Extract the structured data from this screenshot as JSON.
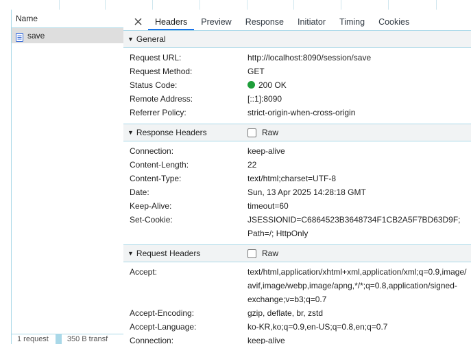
{
  "request_list": {
    "column_header": "Name",
    "selected_request": "save",
    "footer": {
      "requests": "1 request",
      "transferred": "350 B transf"
    }
  },
  "detail": {
    "tabs": [
      {
        "label": "Headers",
        "active": true
      },
      {
        "label": "Preview",
        "active": false
      },
      {
        "label": "Response",
        "active": false
      },
      {
        "label": "Initiator",
        "active": false
      },
      {
        "label": "Timing",
        "active": false
      },
      {
        "label": "Cookies",
        "active": false
      }
    ],
    "general": {
      "title": "General",
      "rows": [
        {
          "key": "Request URL:",
          "value": "http://localhost:8090/session/save"
        },
        {
          "key": "Request Method:",
          "value": "GET"
        },
        {
          "key": "Status Code:",
          "value": "200 OK"
        },
        {
          "key": "Remote Address:",
          "value": "[::1]:8090"
        },
        {
          "key": "Referrer Policy:",
          "value": "strict-origin-when-cross-origin"
        }
      ]
    },
    "response_headers": {
      "title": "Response Headers",
      "raw_label": "Raw",
      "rows": [
        {
          "key": "Connection:",
          "lines": [
            "keep-alive"
          ]
        },
        {
          "key": "Content-Length:",
          "lines": [
            "22"
          ]
        },
        {
          "key": "Content-Type:",
          "lines": [
            "text/html;charset=UTF-8"
          ]
        },
        {
          "key": "Date:",
          "lines": [
            "Sun, 13 Apr 2025 14:28:18 GMT"
          ]
        },
        {
          "key": "Keep-Alive:",
          "lines": [
            "timeout=60"
          ]
        },
        {
          "key": "Set-Cookie:",
          "lines": [
            "JSESSIONID=C6864523B3648734F1CB2A5F7BD63D9F;",
            "Path=/; HttpOnly"
          ]
        }
      ]
    },
    "request_headers": {
      "title": "Request Headers",
      "raw_label": "Raw",
      "rows": [
        {
          "key": "Accept:",
          "lines": [
            "text/html,application/xhtml+xml,application/xml;q=0.9,image/",
            "avif,image/webp,image/apng,*/*;q=0.8,application/signed-",
            "exchange;v=b3;q=0.7"
          ]
        },
        {
          "key": "Accept-Encoding:",
          "lines": [
            "gzip, deflate, br, zstd"
          ]
        },
        {
          "key": "Accept-Language:",
          "lines": [
            "ko-KR,ko;q=0.9,en-US;q=0.8,en;q=0.7"
          ]
        },
        {
          "key": "Connection:",
          "lines": [
            "keep-alive"
          ]
        }
      ]
    },
    "colors": {
      "status_ok": "#1e9e3a",
      "active_tab_underline": "#1a73e8",
      "divider": "#a9d8e8"
    }
  }
}
